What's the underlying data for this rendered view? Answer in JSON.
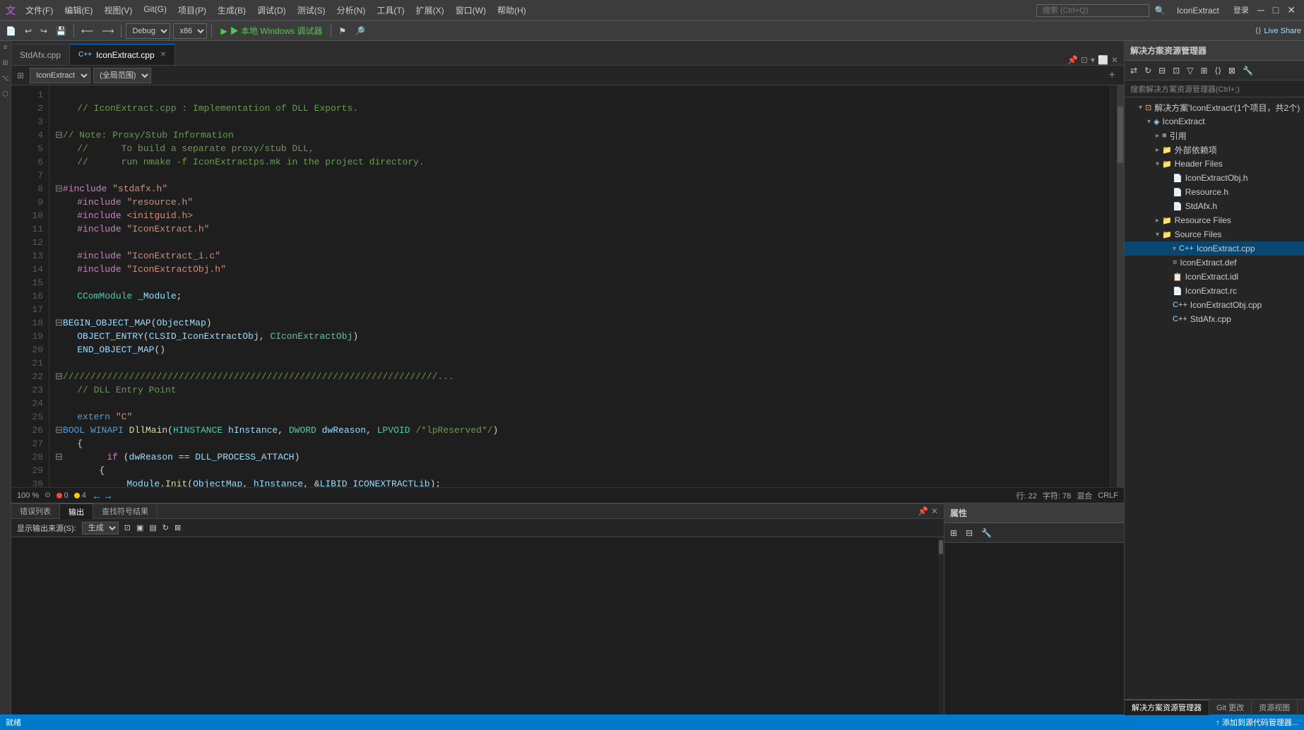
{
  "titlebar": {
    "menus": [
      "文件(F)",
      "编辑(E)",
      "视图(V)",
      "Git(G)",
      "项目(P)",
      "生成(B)",
      "调试(D)",
      "测试(S)",
      "分析(N)",
      "工具(T)",
      "扩展(X)",
      "窗口(W)",
      "帮助(H)"
    ],
    "search_placeholder": "搜索 (Ctrl+Q)",
    "title": "IconExtract",
    "login": "登录",
    "window_min": "─",
    "window_max": "□",
    "window_close": "✕"
  },
  "toolbar": {
    "debug_config": "Debug",
    "platform": "x86",
    "run_label": "▶ 本地 Windows 调试器",
    "live_share": "Live Share"
  },
  "tabs": {
    "items": [
      {
        "label": "StdAfx.cpp",
        "active": false,
        "closable": false
      },
      {
        "label": "IconExtract.cpp",
        "active": true,
        "closable": true,
        "modified": false
      }
    ]
  },
  "editor_nav": {
    "context": "IconExtract",
    "scope": "(全局范围)"
  },
  "code": {
    "lines": [
      {
        "num": 1,
        "text": ""
      },
      {
        "num": 2,
        "text": "    // IconExtract.cpp : Implementation of DLL Exports."
      },
      {
        "num": 3,
        "text": ""
      },
      {
        "num": 4,
        "text": "// Note: Proxy/Stub Information"
      },
      {
        "num": 5,
        "text": "//      To build a separate proxy/stub DLL,"
      },
      {
        "num": 6,
        "text": "//      run nmake -f IconExtractps.mk in the project directory."
      },
      {
        "num": 7,
        "text": ""
      },
      {
        "num": 8,
        "text": "#include \"stdafx.h\""
      },
      {
        "num": 9,
        "text": "    #include \"resource.h\""
      },
      {
        "num": 10,
        "text": "    #include <initguid.h>"
      },
      {
        "num": 11,
        "text": "    #include \"IconExtract.h\""
      },
      {
        "num": 12,
        "text": ""
      },
      {
        "num": 13,
        "text": "    #include \"IconExtract_i.c\""
      },
      {
        "num": 14,
        "text": "    #include \"IconExtractObj.h\""
      },
      {
        "num": 15,
        "text": ""
      },
      {
        "num": 16,
        "text": "    CComModule _Module;"
      },
      {
        "num": 17,
        "text": ""
      },
      {
        "num": 18,
        "text": "BEGIN_OBJECT_MAP(ObjectMap)"
      },
      {
        "num": 19,
        "text": "    OBJECT_ENTRY(CLSID_IconExtractObj, CIconExtractObj)"
      },
      {
        "num": 20,
        "text": "    END_OBJECT_MAP()"
      },
      {
        "num": 21,
        "text": ""
      },
      {
        "num": 22,
        "text": "///////////////////////////////////////////////////////////..."
      },
      {
        "num": 23,
        "text": "    // DLL Entry Point"
      },
      {
        "num": 24,
        "text": ""
      },
      {
        "num": 25,
        "text": "    extern \"C\""
      },
      {
        "num": 26,
        "text": "BOOL WINAPI DllMain(HINSTANCE hInstance, DWORD dwReason, LPVOID /*lpReserved*/)"
      },
      {
        "num": 27,
        "text": "    {"
      },
      {
        "num": 28,
        "text": "        if (dwReason == DLL_PROCESS_ATTACH)"
      },
      {
        "num": 29,
        "text": "        {"
      },
      {
        "num": 30,
        "text": "            Module.Init(ObjectMap, hInstance, &LIBID_ICONEXTRACTLib);"
      }
    ]
  },
  "status": {
    "zoom": "100 %",
    "errors": "0",
    "warnings": "4",
    "line": "行: 22",
    "col": "字符: 78",
    "mixed": "混合",
    "eol": "CRLF"
  },
  "solution_explorer": {
    "title": "解决方案资源管理器",
    "search_placeholder": "搜索解决方案资源管理器(Ctrl+;)",
    "solution_label": "解决方案'IconExtract'(1个项目，共2个)",
    "project": "IconExtract",
    "nodes": [
      {
        "label": "引用",
        "indent": 3,
        "icon": "ref",
        "expandable": true
      },
      {
        "label": "外部依赖项",
        "indent": 3,
        "icon": "folder",
        "expandable": true
      },
      {
        "label": "Header Files",
        "indent": 3,
        "icon": "folder",
        "expandable": true
      },
      {
        "label": "IconExtractObj.h",
        "indent": 5,
        "icon": "h"
      },
      {
        "label": "Resource.h",
        "indent": 5,
        "icon": "h"
      },
      {
        "label": "StdAfx.h",
        "indent": 5,
        "icon": "h"
      },
      {
        "label": "Resource Files",
        "indent": 3,
        "icon": "folder",
        "expandable": true
      },
      {
        "label": "Source Files",
        "indent": 3,
        "icon": "folder",
        "expandable": true,
        "expanded": true
      },
      {
        "label": "IconExtract.cpp",
        "indent": 5,
        "icon": "cpp",
        "selected": true
      },
      {
        "label": "IconExtract.def",
        "indent": 5,
        "icon": "def"
      },
      {
        "label": "IconExtract.idl",
        "indent": 5,
        "icon": "idl"
      },
      {
        "label": "IconExtract.rc",
        "indent": 5,
        "icon": "rc"
      },
      {
        "label": "IconExtractObj.cpp",
        "indent": 5,
        "icon": "cpp"
      },
      {
        "label": "StdAfx.cpp",
        "indent": 5,
        "icon": "cpp"
      }
    ],
    "bottom_tabs": [
      "解决方案资源管理器",
      "Git 更改",
      "资源视图"
    ]
  },
  "output_panel": {
    "title": "输出",
    "source_label": "显示输出来源(S):",
    "source": "生成",
    "bottom_tabs": [
      "错误列表",
      "输出",
      "查找符号结果"
    ]
  },
  "properties_panel": {
    "title": "属性"
  },
  "statusbar": {
    "left": "就绪",
    "right": "↑ 添加到源代码管理器..."
  }
}
